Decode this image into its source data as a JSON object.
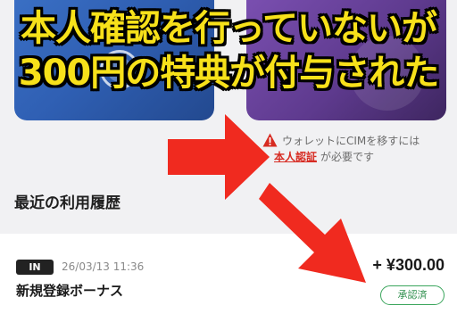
{
  "headline": {
    "line1": "本人確認を行っていないが",
    "line2": "300円の特典が付与された"
  },
  "warning": {
    "text_before": "ウォレットにCIMを移すには",
    "link_text": "本人認証",
    "text_after": "が必要です"
  },
  "history": {
    "title": "最近の利用履歴",
    "transaction": {
      "badge": "IN",
      "datetime": "26/03/13 11:36",
      "name": "新規登録ボーナス",
      "amount": "+ ¥300.00",
      "status": "承認済"
    }
  },
  "colors": {
    "headline": "#f7e11a",
    "arrow": "#f02a1f",
    "link": "#d72b22",
    "status": "#3aa55c"
  },
  "icons": [
    "warning-icon",
    "arrow-right",
    "arrow-down-right"
  ]
}
